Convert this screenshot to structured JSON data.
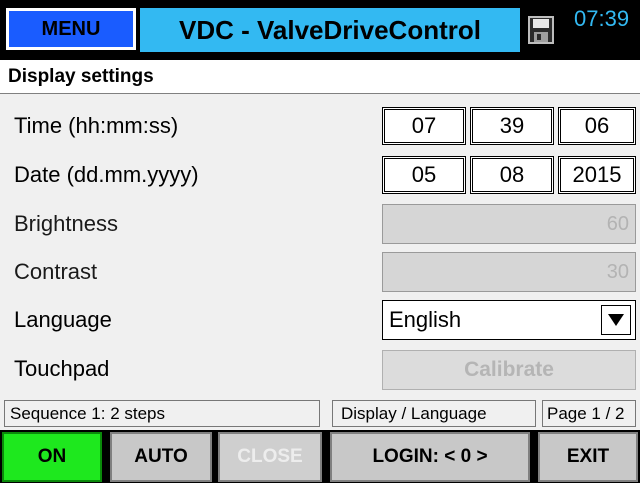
{
  "header": {
    "menu_label": "MENU",
    "title": "VDC - ValveDriveControl",
    "save_icon": "floppy-disk-icon",
    "time": "07:39"
  },
  "section_title": "Display settings",
  "rows": {
    "time": {
      "label": "Time (hh:mm:ss)",
      "hh": "07",
      "mm": "39",
      "ss": "06"
    },
    "date": {
      "label": "Date (dd.mm.yyyy)",
      "dd": "05",
      "mm": "08",
      "yyyy": "2015"
    },
    "brightness": {
      "label": "Brightness",
      "value": "60"
    },
    "contrast": {
      "label": "Contrast",
      "value": "30"
    },
    "language": {
      "label": "Language",
      "value": "English",
      "arrow_icon": "dropdown-arrow-icon"
    },
    "touchpad": {
      "label": "Touchpad",
      "button": "Calibrate"
    }
  },
  "status": {
    "sequence": "Sequence 1: 2 steps",
    "view": "Display / Language",
    "page": "Page 1 / 2"
  },
  "footer": {
    "on": "ON",
    "auto": "AUTO",
    "close": "CLOSE",
    "login": "LOGIN: < 0 >",
    "exit": "EXIT"
  },
  "colors": {
    "menu_blue": "#1a5cff",
    "title_cyan": "#33b9f2",
    "on_green": "#1ee81e"
  }
}
